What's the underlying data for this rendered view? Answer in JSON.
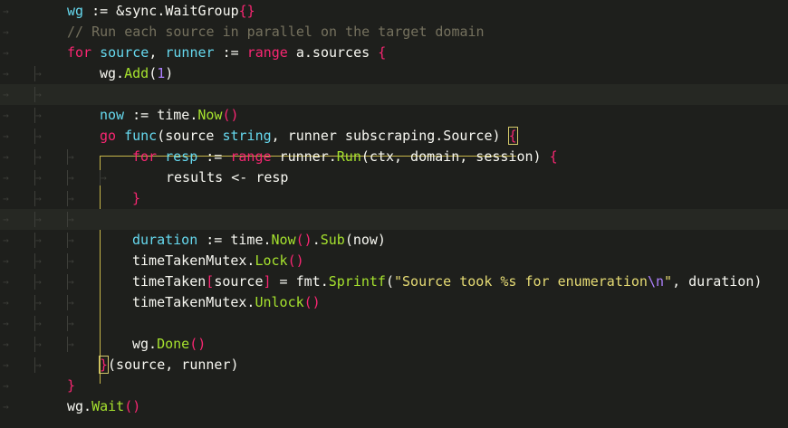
{
  "editor": {
    "theme_colors": {
      "background": "#1e1f1c",
      "keyword": "#f92672",
      "type": "#66d9ef",
      "function": "#a6e22e",
      "number": "#ae81ff",
      "string": "#e6db74",
      "comment": "#75715e",
      "bracket_match": "#c8b74a"
    },
    "whitespace_glyphs": {
      "tab": "→",
      "space": "·"
    },
    "lines": [
      {
        "segments": [
          [
            "wg",
            "ty"
          ],
          [
            " := &sync.WaitGroup",
            ""
          ],
          [
            "{}",
            "brace"
          ]
        ]
      },
      {
        "segments": [
          [
            "// Run each source in parallel on the target domain",
            "cmt"
          ]
        ]
      },
      {
        "segments": [
          [
            "for",
            "kw"
          ],
          [
            " ",
            ""
          ],
          [
            "source",
            "ty"
          ],
          [
            ", ",
            ""
          ],
          [
            "runner",
            "ty"
          ],
          [
            " := ",
            ""
          ],
          [
            "range",
            "kw"
          ],
          [
            " a.sources ",
            ""
          ],
          [
            "{",
            "brace"
          ]
        ]
      },
      {
        "segments": [
          [
            "wg.",
            ""
          ],
          [
            "Add",
            "fn"
          ],
          [
            "(",
            ""
          ],
          [
            "1",
            "num"
          ],
          [
            ")",
            ""
          ]
        ]
      },
      {
        "segments": []
      },
      {
        "segments": [
          [
            "now",
            "ty"
          ],
          [
            " := time.",
            ""
          ],
          [
            "Now",
            "fn"
          ],
          [
            "()",
            "brace"
          ]
        ]
      },
      {
        "segments": [
          [
            "go",
            "kw"
          ],
          [
            " ",
            ""
          ],
          [
            "func",
            "ty"
          ],
          [
            "(source ",
            ""
          ],
          [
            "string",
            "ty"
          ],
          [
            ", runner subscraping.Source) ",
            ""
          ],
          [
            "{",
            "brace"
          ]
        ]
      },
      {
        "segments": [
          [
            "for",
            "kw"
          ],
          [
            " ",
            ""
          ],
          [
            "resp",
            "ty"
          ],
          [
            " := ",
            ""
          ],
          [
            "range",
            "kw"
          ],
          [
            " runner.",
            ""
          ],
          [
            "Run",
            "fn"
          ],
          [
            "(ctx, domain, session) ",
            ""
          ],
          [
            "{",
            "brace"
          ]
        ]
      },
      {
        "segments": [
          [
            "results <- resp",
            ""
          ]
        ]
      },
      {
        "segments": [
          [
            "}",
            "brace"
          ]
        ]
      },
      {
        "segments": []
      },
      {
        "segments": [
          [
            "duration",
            "ty"
          ],
          [
            " := time.",
            ""
          ],
          [
            "Now",
            "fn"
          ],
          [
            "()",
            "brace"
          ],
          [
            ".",
            ""
          ],
          [
            "Sub",
            "fn"
          ],
          [
            "(now)",
            ""
          ]
        ]
      },
      {
        "segments": [
          [
            "timeTakenMutex.",
            ""
          ],
          [
            "Lock",
            "fn"
          ],
          [
            "()",
            "brace"
          ]
        ]
      },
      {
        "segments": [
          [
            "timeTaken",
            ""
          ],
          [
            "[",
            "brace"
          ],
          [
            "source",
            ""
          ],
          [
            "]",
            "brace"
          ],
          [
            " = fmt.",
            ""
          ],
          [
            "Sprintf",
            "fn"
          ],
          [
            "(",
            ""
          ],
          [
            "\"Source took %s for enumeration",
            "str"
          ],
          [
            "\\n",
            "esc"
          ],
          [
            "\"",
            "str"
          ],
          [
            ", duration)",
            ""
          ]
        ]
      },
      {
        "segments": [
          [
            "timeTakenMutex.",
            ""
          ],
          [
            "Unlock",
            "fn"
          ],
          [
            "()",
            "brace"
          ]
        ]
      },
      {
        "segments": []
      },
      {
        "segments": [
          [
            "wg.",
            ""
          ],
          [
            "Done",
            "fn"
          ],
          [
            "()",
            "brace"
          ]
        ]
      },
      {
        "segments": [
          [
            "}",
            "brace"
          ],
          [
            "(source, runner)",
            ""
          ]
        ]
      },
      {
        "segments": [
          [
            "}",
            "brace"
          ]
        ]
      },
      {
        "segments": [
          [
            "wg.",
            ""
          ],
          [
            "Wait",
            "fn"
          ],
          [
            "()",
            "brace"
          ]
        ]
      }
    ]
  }
}
